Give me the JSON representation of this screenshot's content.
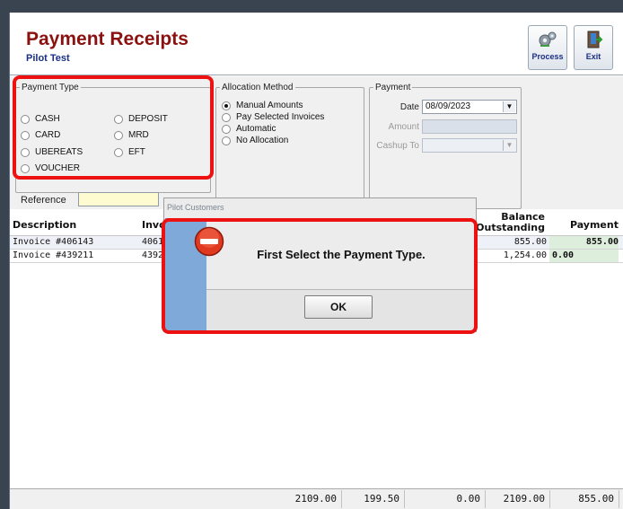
{
  "app": {
    "title": "Payment Receipts",
    "subtitle": "Pilot Test"
  },
  "toolbar": {
    "process_label": "Process",
    "exit_label": "Exit"
  },
  "payment_type": {
    "legend": "Payment Type",
    "options": [
      {
        "label": "CASH",
        "selected": false
      },
      {
        "label": "DEPOSIT",
        "selected": false
      },
      {
        "label": "CARD",
        "selected": false
      },
      {
        "label": "MRD",
        "selected": false
      },
      {
        "label": "UBEREATS",
        "selected": false
      },
      {
        "label": "EFT",
        "selected": false
      },
      {
        "label": "VOUCHER",
        "selected": false
      }
    ]
  },
  "reference": {
    "label": "Reference",
    "value": ""
  },
  "allocation": {
    "legend": "Allocation Method",
    "options": [
      {
        "label": "Manual Amounts",
        "selected": true
      },
      {
        "label": "Pay Selected Invoices",
        "selected": false
      },
      {
        "label": "Automatic",
        "selected": false
      },
      {
        "label": "No Allocation",
        "selected": false
      }
    ]
  },
  "payment": {
    "legend": "Payment",
    "date_label": "Date",
    "date_value": "08/09/2023",
    "amount_label": "Amount",
    "amount_value": "",
    "cashup_label": "Cashup To",
    "cashup_value": ""
  },
  "grid": {
    "headers": {
      "description": "Description",
      "invoice": "Invo",
      "balance_line1": "Balance",
      "balance_line2": "Outstanding",
      "payment": "Payment"
    },
    "rows": [
      {
        "description": "Invoice #406143",
        "invoice": "4061",
        "balance": "855.00",
        "payment": "855.00"
      },
      {
        "description": "Invoice #439211",
        "invoice": "4392",
        "balance": "1,254.00",
        "payment": "0.00"
      }
    ]
  },
  "footer": {
    "totals": [
      "2109.00",
      "199.50",
      "0.00",
      "2109.00",
      "855.00"
    ]
  },
  "dialog": {
    "title": "Pilot Customers",
    "message": "First Select the Payment Type.",
    "ok_label": "OK"
  },
  "colors": {
    "title": "#8b1111",
    "subtitle": "#1a2f86",
    "highlight": "#ee1111",
    "dialog_strip": "#7fa9d9"
  }
}
